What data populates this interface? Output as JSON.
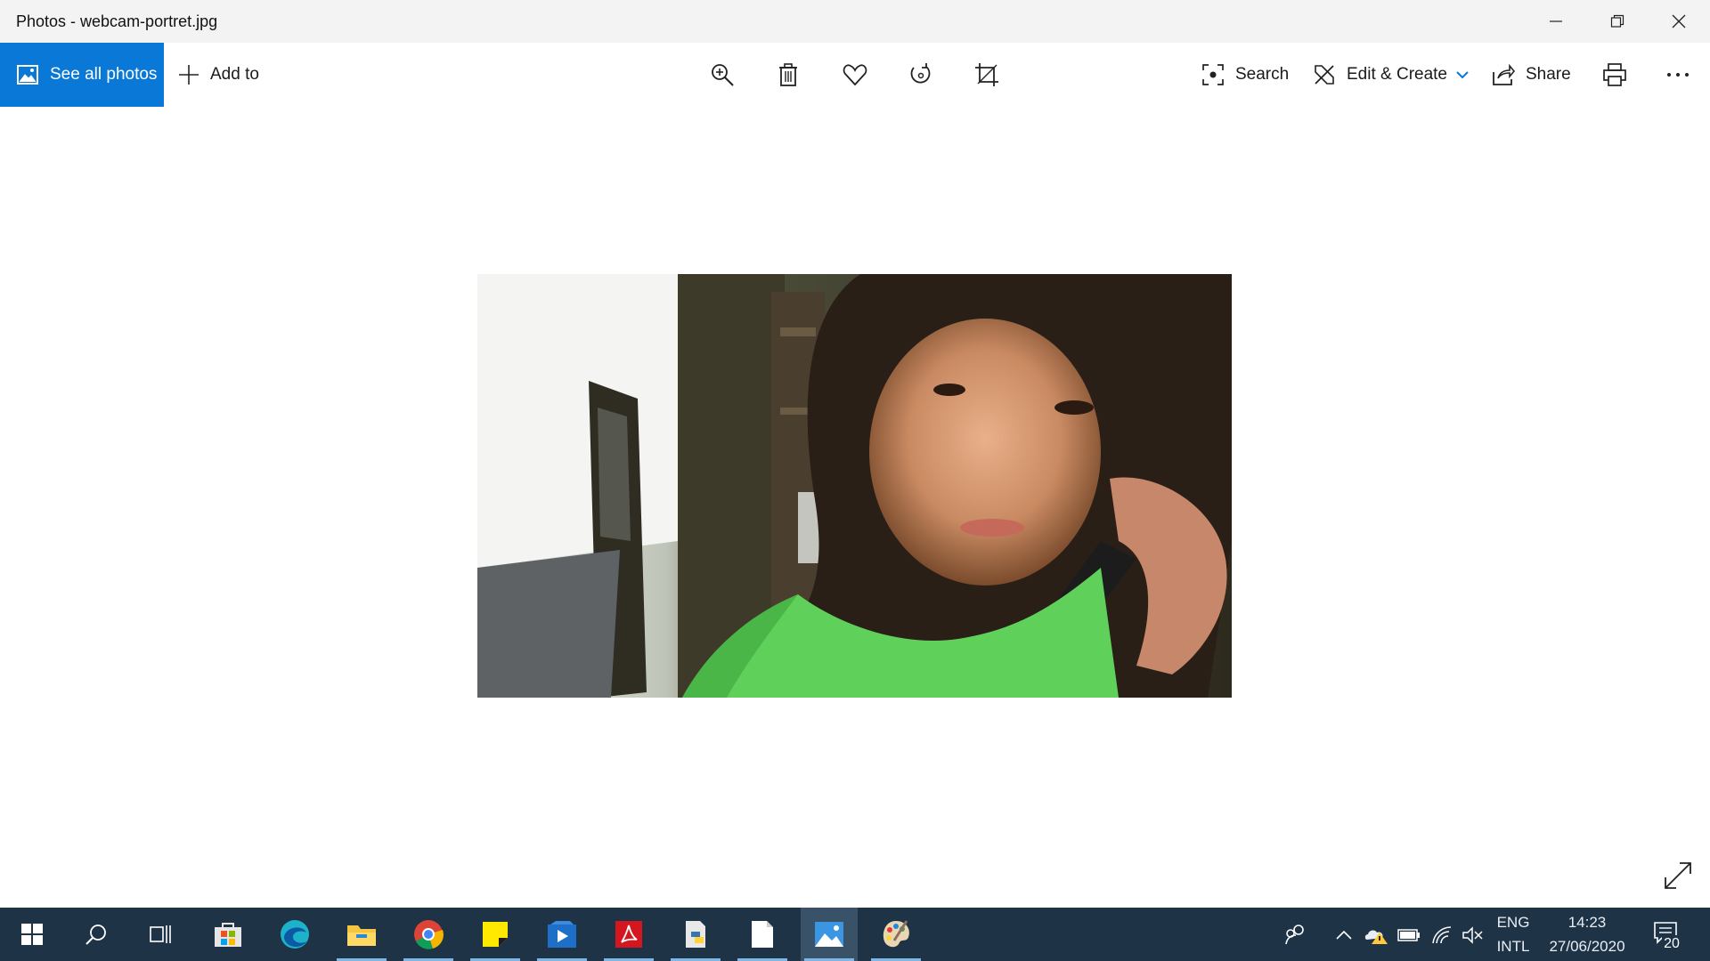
{
  "window": {
    "title": "Photos - webcam-portret.jpg"
  },
  "toolbar": {
    "see_all_photos": "See all photos",
    "add_to": "Add to",
    "search": "Search",
    "edit_create": "Edit & Create",
    "share": "Share",
    "icons": [
      "zoom-icon",
      "delete-icon",
      "heart-icon",
      "rotate-icon",
      "crop-icon",
      "print-icon",
      "more-icon"
    ]
  },
  "colors": {
    "accent": "#0a78d7",
    "taskbar": "#1f3346"
  },
  "taskbar": {
    "apps": [
      "start-button",
      "search",
      "task-view",
      "microsoft-store",
      "edge",
      "file-explorer",
      "chrome",
      "sticky-notes",
      "media-player",
      "acrobat",
      "python",
      "notepad",
      "photos",
      "paint"
    ],
    "language": "ENG",
    "layout": "INTL",
    "time": "14:23",
    "date": "27/06/2020",
    "notifications": "20"
  }
}
